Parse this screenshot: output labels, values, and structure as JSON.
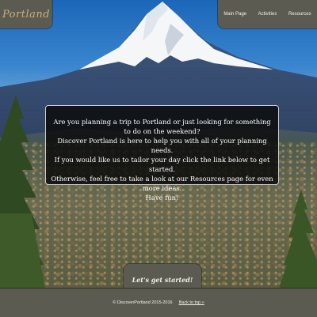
{
  "header": {
    "logo_text": "Portland",
    "nav": [
      {
        "label": "Main Page"
      },
      {
        "label": "Activities"
      },
      {
        "label": "Resources"
      }
    ]
  },
  "intro": {
    "lines": [
      "Are you planning a trip to Portland or just looking for something to do on the weekend?",
      "Discover Portland is here to help you with all of your planning needs.",
      "If you would like us to tailor your day click the link below to get started.",
      "Otherwise, feel free to take a look at our Resources page for even more ideas.",
      "Have fun!"
    ]
  },
  "cta": {
    "label": "Let's get started!"
  },
  "footer": {
    "copyright": "© DiscoverPortland 2015-2016",
    "back_to_top": "Back to top »"
  },
  "colors": {
    "panel": "#5b5b51",
    "logo": "#c9b27a",
    "intro_bg": "#0c0c0c",
    "sky": "#3b86cf"
  },
  "background": {
    "icon": "mountain-landscape-image"
  }
}
